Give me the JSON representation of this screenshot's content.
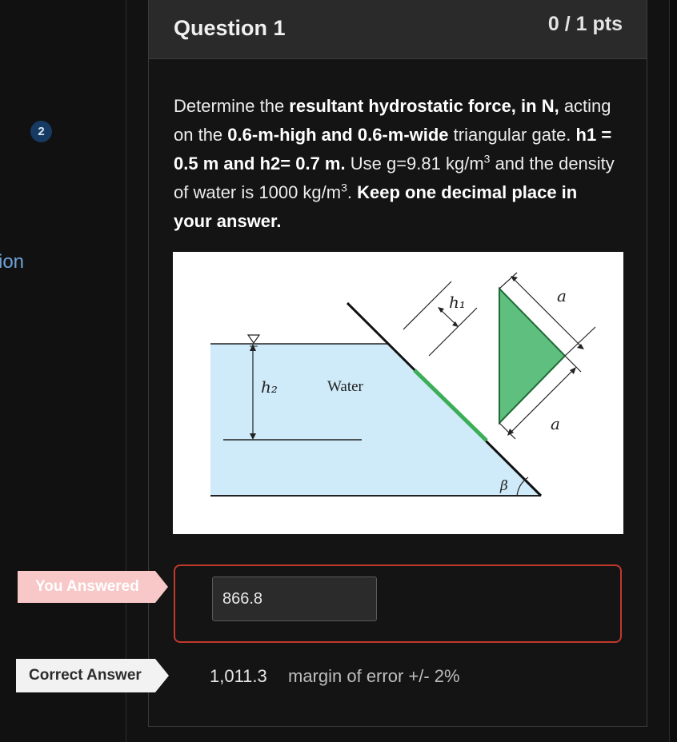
{
  "sidebar": {
    "badge": "2",
    "nav_fragment": "ion"
  },
  "question": {
    "title": "Question 1",
    "points": "0 / 1 pts",
    "text": {
      "p1": "Determine the ",
      "b1": "resultant hydrostatic force, in N,",
      "p2": " acting on the ",
      "b2": "0.6-m-high and 0.6-m-wide",
      "p3": " triangular gate. ",
      "b3": "h1 = 0.5 m and h2= 0.7 m.",
      "p4": " Use g=9.81 kg/m",
      "sup1": "3",
      "p5": " and the density of water is 1000 kg/m",
      "sup2": "3",
      "p6": ". ",
      "b4": "Keep one decimal place in your answer."
    }
  },
  "figure": {
    "label_h1": "h₁",
    "label_h2": "h₂",
    "label_water": "Water",
    "label_a_top": "a",
    "label_a_bottom": "a",
    "label_beta": "β",
    "water_color": "#cfeaf8",
    "gate_color": "#5fbf7f"
  },
  "answers": {
    "you_answered_label": "You Answered",
    "your_answer": "866.8",
    "correct_answer_label": "Correct Answer",
    "correct_value": "1,011.3",
    "margin": "margin of error +/- 2%"
  },
  "colors": {
    "accent_blue": "#6ea0d8",
    "wrong_border": "#c0392b",
    "you_answered_bg": "#f8c7c7"
  }
}
